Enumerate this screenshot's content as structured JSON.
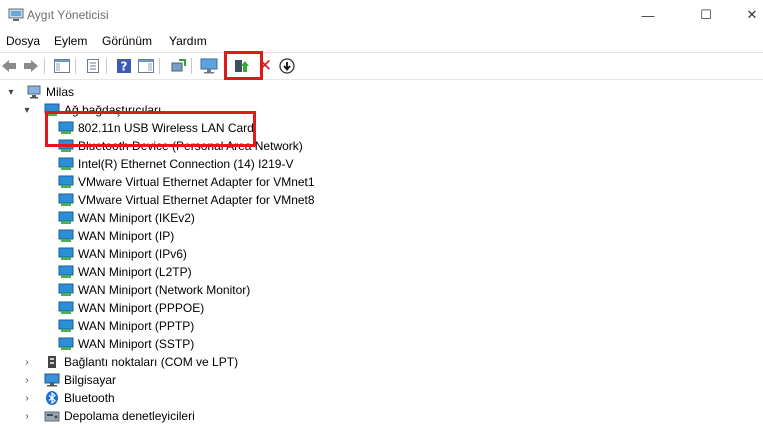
{
  "window": {
    "title": "Aygıt Yöneticisi",
    "minimize": "—",
    "maximize": "☐",
    "close": "✕"
  },
  "menu": [
    "Dosya",
    "Eylem",
    "Görünüm",
    "Yardım"
  ],
  "toolbar": {
    "buttons": [
      "back-icon",
      "forward-icon",
      "show-hide-console-tree-icon",
      "properties-icon",
      "help-icon",
      "action-pane-icon",
      "scan-hardware-icon",
      "monitor-icon",
      "update-driver-icon",
      "uninstall-icon",
      "disable-icon"
    ],
    "delete_glyph": "✕",
    "down_glyph": "↓"
  },
  "tree": {
    "root": {
      "label": "Milas",
      "expanded": true
    },
    "network": {
      "label": "Ağ bağdaştırıcıları",
      "expanded": true,
      "items": [
        "802.11n USB Wireless LAN Card",
        "Bluetooth Device (Personal Area Network)",
        "Intel(R) Ethernet Connection (14) I219-V",
        "VMware Virtual Ethernet Adapter for VMnet1",
        "VMware Virtual Ethernet Adapter for VMnet8",
        "WAN Miniport (IKEv2)",
        "WAN Miniport (IP)",
        "WAN Miniport (IPv6)",
        "WAN Miniport (L2TP)",
        "WAN Miniport (Network Monitor)",
        "WAN Miniport (PPPOE)",
        "WAN Miniport (PPTP)",
        "WAN Miniport (SSTP)"
      ]
    },
    "categories": [
      {
        "label": "Bağlantı noktaları (COM ve LPT)",
        "icon": "port-icon"
      },
      {
        "label": "Bilgisayar",
        "icon": "computer-icon"
      },
      {
        "label": "Bluetooth",
        "icon": "bluetooth-icon"
      },
      {
        "label": "Depolama denetleyicileri",
        "icon": "storage-controller-icon"
      }
    ]
  },
  "colors": {
    "highlight": "#e0191b",
    "nic_blue": "#2b8fd8",
    "nic_green": "#4caf50"
  }
}
